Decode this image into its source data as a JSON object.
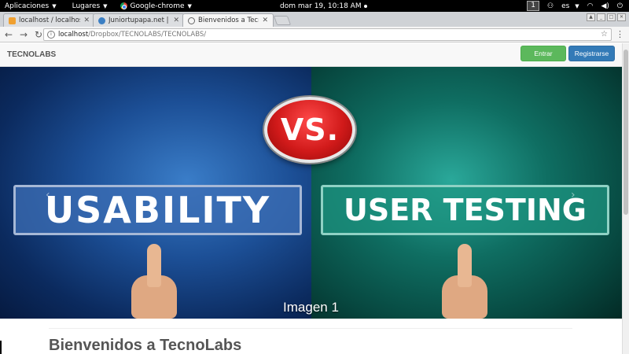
{
  "system_bar": {
    "apps_menu": "Aplicaciones",
    "places_menu": "Lugares",
    "app_menu": "Google-chrome",
    "clock": "dom mar 19, 10:18 AM",
    "workspace": "1",
    "language": "es"
  },
  "tabs": [
    {
      "title": "localhost / localhost",
      "active": false
    },
    {
      "title": "Juniortupapa.net | R",
      "active": false
    },
    {
      "title": "Bienvenidos a Tecno",
      "active": true
    }
  ],
  "address_bar": {
    "host": "localhost",
    "path": "/Dropbox/TECNOLABS/TECNOLABS/"
  },
  "navbar": {
    "brand": "TECNOLABS",
    "login_label": "Entrar",
    "register_label": "Registrarse"
  },
  "carousel": {
    "vs_text": "VS.",
    "left_sign": "USABILITY",
    "right_sign": "USER TESTING",
    "caption": "Imagen 1",
    "prev_arrow": "‹",
    "next_arrow": "›",
    "active_slide": 1,
    "slide_count": 3
  },
  "content": {
    "heading": "Bienvenidos a TecnoLabs"
  },
  "colors": {
    "login_button": "#5cb85c",
    "register_button": "#337ab7"
  }
}
